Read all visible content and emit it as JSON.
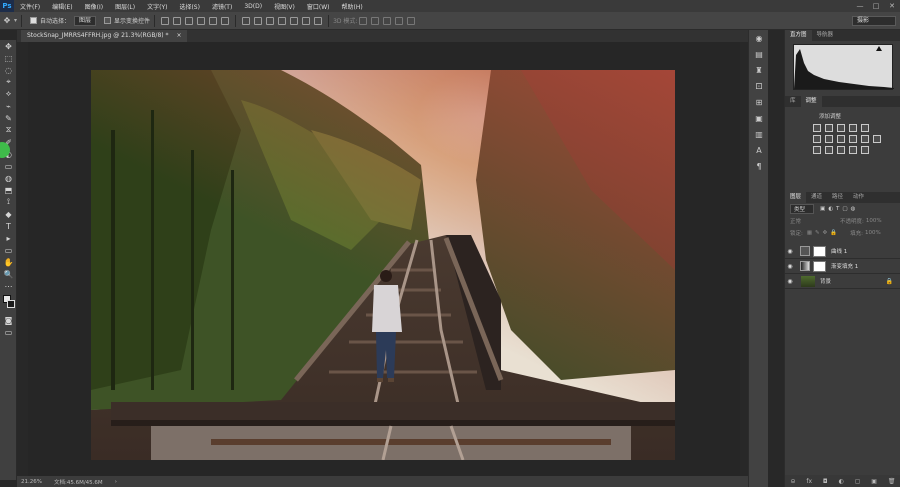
{
  "menubar": {
    "logo": "Ps",
    "items": [
      "文件(F)",
      "编辑(E)",
      "图像(I)",
      "图层(L)",
      "文字(Y)",
      "选择(S)",
      "滤镜(T)",
      "3D(D)",
      "视图(V)",
      "窗口(W)",
      "帮助(H)"
    ],
    "window_controls": [
      "—",
      "□",
      "✕"
    ]
  },
  "optbar": {
    "auto_select_label": "自动选择：",
    "auto_select_value": "图层",
    "show_transform_label": "显示变换控件",
    "mode_3d_label": "3D 模式:",
    "workspace_value": "摄影"
  },
  "document": {
    "tab_title": "StockSnap_JMRRS4FFRH.jpg @ 21.3%(RGB/8) *",
    "tab_close": "×",
    "zoom": "21.26%",
    "doc_size": "文档:45.6M/45.6M",
    "status_arrow": "›"
  },
  "tools": [
    "✥",
    "⬚",
    "◌",
    "⌖",
    "⟡",
    "⌁",
    "✎",
    "⧖",
    "✐",
    "◐",
    "▭",
    "◍",
    "⬒",
    "⟟",
    "◆",
    "T",
    "▸",
    "▭",
    "✋",
    "🔍",
    "⋯",
    "■"
  ],
  "right_strip_icons": [
    "◉",
    "▤",
    "♜",
    "⚀",
    "⊞",
    "▣",
    "▥",
    "A",
    "¶"
  ],
  "panels": {
    "histogram_tabs": [
      "直方图",
      "导航器"
    ],
    "adjust_tabs": [
      "库",
      "调整"
    ],
    "adjust_title": "添加调整",
    "layers_tabs": [
      "图层",
      "通道",
      "路径",
      "动作"
    ],
    "filter_value": "类型",
    "blend_mode": "正常",
    "opacity_label": "不透明度:",
    "opacity_value": "100%",
    "lock_label": "锁定:",
    "fill_label": "填充:",
    "fill_value": "100%",
    "layers": [
      {
        "name": "曲线 1"
      },
      {
        "name": "渐变填充 1"
      },
      {
        "name": "背景"
      }
    ],
    "bottom_icons": [
      "⊝",
      "fx",
      "◘",
      "◐",
      "▢",
      "▣",
      "🗑"
    ]
  }
}
